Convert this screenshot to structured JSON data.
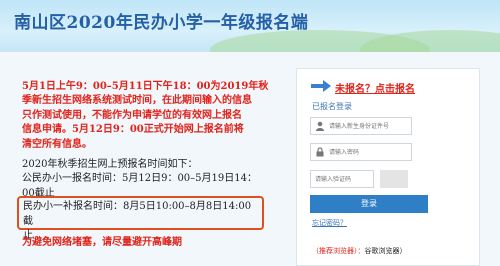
{
  "header": {
    "title": "南山区2020年民办小学一年级报名端"
  },
  "notice": {
    "red_lines": [
      "5月1日上午9：00–5月11日下午18：00为2019年秋",
      "季新生招生网络系统测试时间，在此期间输入的信息",
      "只作测试使用，不能作为申请学位的有效网上报名",
      "信息申请。5月12日9：00正式开始网上报名前将",
      "清空所有信息。"
    ],
    "schedule_lines": [
      "2020年秋季招生网上预报名时间如下：",
      "公民办小一报名时间：5月12日9：00–5月19日14：",
      "00截止"
    ],
    "highlight_lines": [
      "民办小一补报名时间：8月5日10:00–8月8日14:00截",
      "止"
    ],
    "bottom_red": "为避免网络堵塞，请尽量避开高峰期"
  },
  "login": {
    "unregistered_link": "未报名？点击报名",
    "registered_label": "已报名登录",
    "id_placeholder": "请输入新生身份证件号",
    "password_placeholder": "请输入密码",
    "captcha_placeholder": "请输入验证码",
    "login_button": "登录",
    "forgot_link": "忘记密码？",
    "recommend_label": "（推荐浏览器）：",
    "recommend_browser": "谷歌浏览器）"
  },
  "colors": {
    "notice_red": "#e0231b",
    "title_blue": "#2560a6",
    "button_blue": "#2f7fc6",
    "highlight_border": "#e04f1f"
  }
}
